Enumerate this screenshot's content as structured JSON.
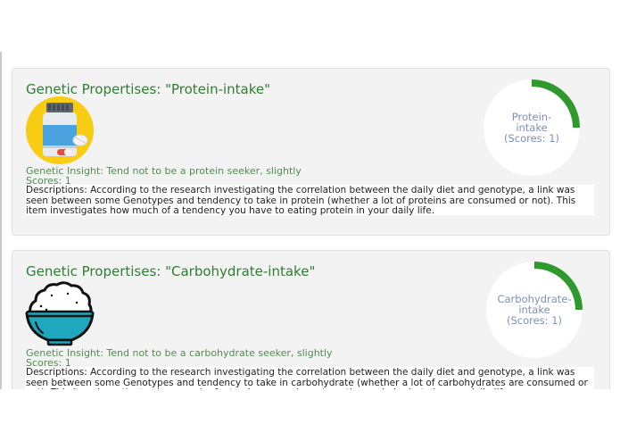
{
  "colors": {
    "card_bg": "#f3f3f3",
    "title": "#2f7d32",
    "insight": "#4f8c4f",
    "gauge_arc": "#2e9a2e",
    "gauge_text": "#7f8fb8"
  },
  "cards": [
    {
      "title": "Genetic Propertises: \"Protein-intake\"",
      "icon": "protein-bottle-icon",
      "insight": "Genetic Insight: Tend not to be a protein seeker, slightly",
      "scores": "Scores: 1",
      "description": "Descriptions: According to the research investigating the correlation between the daily diet and genotype, a link was seen between some Genotypes and tendency to take in protein (whether a lot of proteins are consumed or not). This item investigates how much of a tendency you have to eating protein in your daily life.",
      "gauge": {
        "line1": "Protein-",
        "line2": "intake",
        "line3": "(Scores: 1)",
        "fraction": 0.25
      }
    },
    {
      "title": "Genetic Propertises: \"Carbohydrate-intake\"",
      "icon": "rice-bowl-icon",
      "insight": "Genetic Insight: Tend not to be a carbohydrate seeker, slightly",
      "scores": "Scores: 1",
      "description": "Descriptions: According to the research investigating the correlation between the daily diet and genotype, a link was seen between some Genotypes and tendency to take in carbohydrate (whether a lot of carbohydrates are consumed or not). This item investigates how much of a tendency you have to eating carbohydrate in your daily life.",
      "gauge": {
        "line1": "Carbohydrate-",
        "line2": "intake",
        "line3": "(Scores: 1)",
        "fraction": 0.25
      }
    }
  ]
}
